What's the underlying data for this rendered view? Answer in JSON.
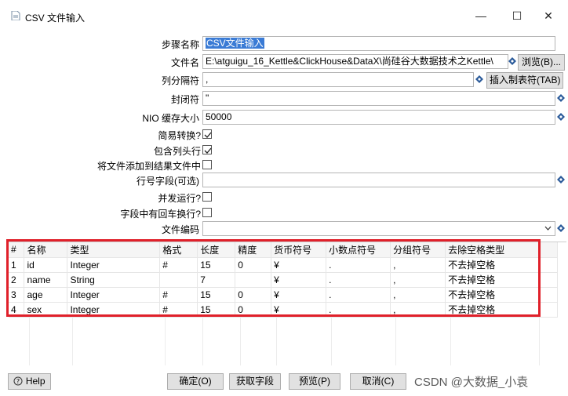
{
  "window": {
    "title": "CSV 文件输入",
    "min": "—",
    "max": "☐",
    "close": "✕"
  },
  "form": {
    "step_name_label": "步骤名称",
    "step_name_value": "CSV文件输入",
    "filename_label": "文件名",
    "filename_value": "E:\\atguigu_16_Kettle&ClickHouse&DataX\\尚硅谷大数据技术之Kettle\\",
    "browse_button": "浏览(B)...",
    "delimiter_label": "列分隔符",
    "delimiter_value": ",",
    "insert_tab_button": "插入制表符(TAB)",
    "enclosure_label": "封闭符",
    "enclosure_value": "\"",
    "nio_label": "NIO 缓存大小",
    "nio_value": "50000",
    "lazy_label": "简易转换?",
    "header_label": "包含列头行",
    "add_file_label": "将文件添加到结果文件中",
    "rownum_label": "行号字段(可选)",
    "rownum_value": "",
    "parallel_label": "并发运行?",
    "newline_label": "字段中有回车换行?",
    "encoding_label": "文件编码",
    "encoding_value": ""
  },
  "checkboxes": {
    "lazy": true,
    "header": true,
    "add_file": false,
    "parallel": false,
    "newline": false
  },
  "grid": {
    "columns": [
      "#",
      "名称",
      "类型",
      "格式",
      "长度",
      "精度",
      "货币符号",
      "小数点符号",
      "分组符号",
      "去除空格类型"
    ],
    "rows": [
      [
        "1",
        "id",
        "Integer",
        "#",
        "15",
        "0",
        "¥",
        ".",
        ",",
        "不去掉空格"
      ],
      [
        "2",
        "name",
        "String",
        "",
        "7",
        "",
        "¥",
        ".",
        ",",
        "不去掉空格"
      ],
      [
        "3",
        "age",
        "Integer",
        "#",
        "15",
        "0",
        "¥",
        ".",
        ",",
        "不去掉空格"
      ],
      [
        "4",
        "sex",
        "Integer",
        "#",
        "15",
        "0",
        "¥",
        ".",
        ",",
        "不去掉空格"
      ]
    ]
  },
  "footer": {
    "help": "Help",
    "ok": "确定(O)",
    "get_fields": "获取字段",
    "preview": "预览(P)",
    "cancel": "取消(C)"
  },
  "watermark": "CSDN @大数据_小袁",
  "colors": {
    "highlight": "#e0202a",
    "selection": "#3a7bd5",
    "variable_icon": "#2a5a9a"
  }
}
